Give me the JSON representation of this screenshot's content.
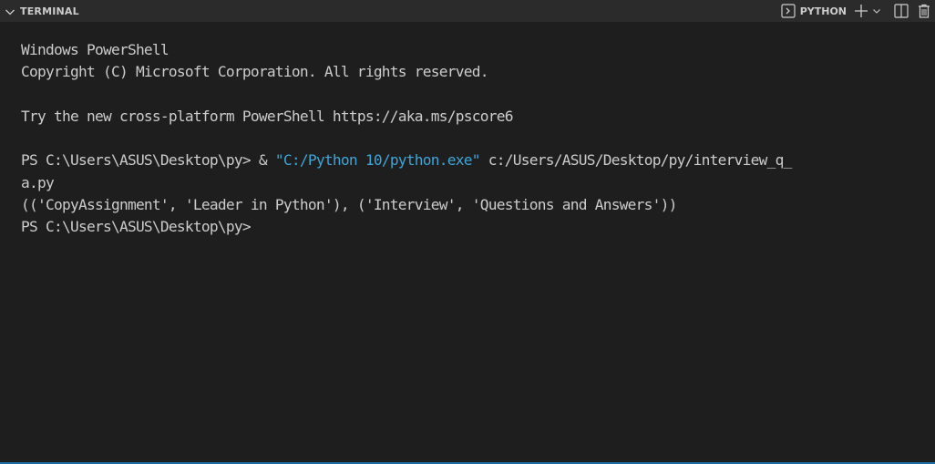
{
  "header": {
    "title": "TERMINAL",
    "shell_name": "PYTHON",
    "icons": [
      "chevron-down-icon",
      "terminal-icon",
      "plus-icon",
      "dropdown-chevron-icon",
      "split-icon",
      "trash-icon"
    ]
  },
  "terminal": {
    "lines": [
      {
        "parts": [
          {
            "text": "Windows PowerShell",
            "type": "plain"
          }
        ]
      },
      {
        "parts": [
          {
            "text": "Copyright (C) Microsoft Corporation. All rights reserved.",
            "type": "plain"
          }
        ]
      },
      {
        "parts": [
          {
            "text": "",
            "type": "plain"
          }
        ]
      },
      {
        "parts": [
          {
            "text": "Try the new cross-platform PowerShell https://aka.ms/pscore6",
            "type": "plain"
          }
        ]
      },
      {
        "parts": [
          {
            "text": "",
            "type": "plain"
          }
        ]
      },
      {
        "parts": [
          {
            "text": "PS C:\\Users\\ASUS\\Desktop\\py> & ",
            "type": "plain"
          },
          {
            "text": "\"C:/Python 10/python.exe\"",
            "type": "string"
          },
          {
            "text": " c:/Users/ASUS/Desktop/py/interview_q_",
            "type": "plain"
          }
        ]
      },
      {
        "parts": [
          {
            "text": "a.py",
            "type": "plain"
          }
        ]
      },
      {
        "parts": [
          {
            "text": "(('CopyAssignment', 'Leader in Python'), ('Interview', 'Questions and Answers'))",
            "type": "plain"
          }
        ]
      },
      {
        "parts": [
          {
            "text": "PS C:\\Users\\ASUS\\Desktop\\py>",
            "type": "plain"
          }
        ]
      }
    ]
  }
}
